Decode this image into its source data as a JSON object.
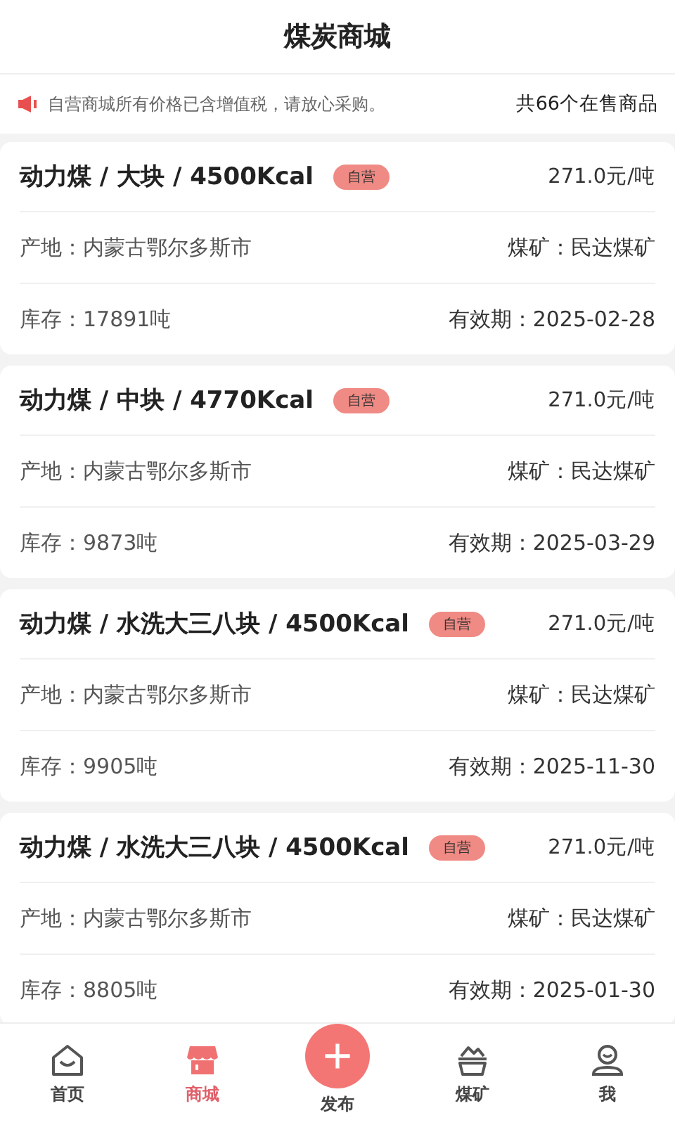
{
  "header": {
    "title": "煤炭商城"
  },
  "notice": {
    "text": "自营商城所有价格已含增值税，请放心采购。",
    "count": "共66个在售商品"
  },
  "products": [
    {
      "title": "动力煤 / 大块 / 4500Kcal",
      "badge": "自营",
      "price": "271.0元/吨",
      "origin": "产地：内蒙古鄂尔多斯市",
      "mine": "煤矿：民达煤矿",
      "stock": "库存：17891吨",
      "expiry": "有效期：2025-02-28"
    },
    {
      "title": "动力煤 / 中块 / 4770Kcal",
      "badge": "自营",
      "price": "271.0元/吨",
      "origin": "产地：内蒙古鄂尔多斯市",
      "mine": "煤矿：民达煤矿",
      "stock": "库存：9873吨",
      "expiry": "有效期：2025-03-29"
    },
    {
      "title": "动力煤 / 水洗大三八块 / 4500Kcal",
      "badge": "自营",
      "price": "271.0元/吨",
      "origin": "产地：内蒙古鄂尔多斯市",
      "mine": "煤矿：民达煤矿",
      "stock": "库存：9905吨",
      "expiry": "有效期：2025-11-30"
    },
    {
      "title": "动力煤 / 水洗大三八块 / 4500Kcal",
      "badge": "自营",
      "price": "271.0元/吨",
      "origin": "产地：内蒙古鄂尔多斯市",
      "mine": "煤矿：民达煤矿",
      "stock": "库存：8805吨",
      "expiry": "有效期：2025-01-30"
    }
  ],
  "tabbar": [
    {
      "kind": "home",
      "label": "首页",
      "selected": false
    },
    {
      "kind": "shop",
      "label": "商城",
      "selected": true
    },
    {
      "kind": "publish",
      "label": "发布",
      "selected": false
    },
    {
      "kind": "mine",
      "label": "煤矿",
      "selected": false
    },
    {
      "kind": "me",
      "label": "我",
      "selected": false
    }
  ]
}
